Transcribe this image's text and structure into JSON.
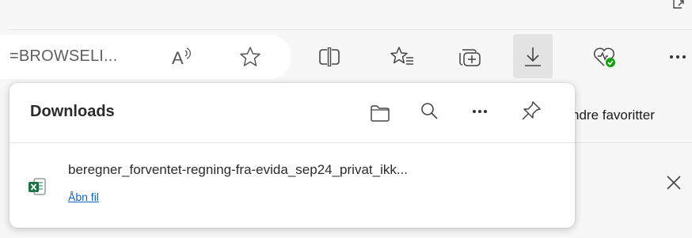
{
  "address_bar": {
    "url_fragment": "=BROWSELI..."
  },
  "toolbar": {
    "icons": [
      "read-aloud-icon",
      "add-favorite-icon",
      "split-screen-icon",
      "favorites-icon",
      "collections-icon",
      "downloads-icon",
      "browser-essentials-icon",
      "more-icon"
    ]
  },
  "favorites_bar": {
    "other_favorites_label": "ndre favoritter"
  },
  "downloads_panel": {
    "title": "Downloads",
    "actions": [
      "open-downloads-folder-icon",
      "search-downloads-icon",
      "more-options-icon",
      "pin-icon"
    ],
    "items": [
      {
        "file_name": "beregner_forventet-regning-fra-evida_sep24_privat_ikk...",
        "action_label": "Åbn fil",
        "file_type_icon": "excel-file-icon"
      }
    ]
  },
  "colors": {
    "accent_link": "#1565c0",
    "excel_green": "#1e7145",
    "health_badge_green": "#13a10e",
    "active_button_bg": "#e3e3e3"
  }
}
